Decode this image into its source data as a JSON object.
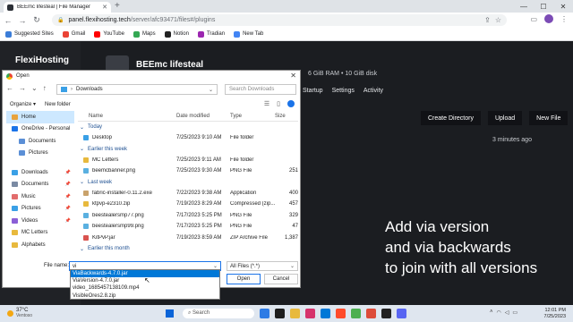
{
  "browser": {
    "tab_title": "BEEmc lifesteal | File Manager",
    "url_host": "panel.flexihosting.tech",
    "url_path": "/server/afc93471/files#/plugins",
    "bookmarks": [
      {
        "label": "Suggested Sites",
        "color": "#3b7dd8"
      },
      {
        "label": "Gmail",
        "color": "#ea4335"
      },
      {
        "label": "YouTube",
        "color": "#ff0000"
      },
      {
        "label": "Maps",
        "color": "#34a853"
      },
      {
        "label": "Notion",
        "color": "#222222"
      },
      {
        "label": "Tradian",
        "color": "#9c27b0"
      },
      {
        "label": "New Tab",
        "color": "#4285f4"
      }
    ]
  },
  "app": {
    "brand": "FlexiHosting",
    "server_title": "BEEmc lifesteal",
    "specs": "6 GiB RAM • 10 GiB disk",
    "nav": [
      "Startup",
      "Settings",
      "Activity"
    ],
    "actions": [
      "Create Directory",
      "Upload",
      "New File"
    ],
    "modified": "3 minutes ago",
    "caption_lines": [
      "Add via version",
      "and via backwards",
      "to join with all versions"
    ]
  },
  "dialog": {
    "title": "Open",
    "path": "Downloads",
    "search_placeholder": "Search Downloads",
    "organize": "Organize ▾",
    "new_folder": "New folder",
    "sidebar": [
      {
        "label": "Home",
        "icon": "home-icon",
        "color": "#e8a33d",
        "selected": true,
        "sub": false,
        "pinned": false
      },
      {
        "label": "OneDrive - Personal",
        "icon": "onedrive-icon",
        "color": "#1a73e8",
        "selected": false,
        "sub": false,
        "pinned": false
      },
      {
        "label": "Documents",
        "icon": "documents-icon",
        "color": "#5b8fd6",
        "selected": false,
        "sub": true,
        "pinned": false
      },
      {
        "label": "Pictures",
        "icon": "pictures-icon",
        "color": "#5b8fd6",
        "selected": false,
        "sub": true,
        "pinned": false
      },
      {
        "label": "",
        "icon": "spacer",
        "color": "transparent",
        "selected": false,
        "sub": false,
        "pinned": false
      },
      {
        "label": "Downloads",
        "icon": "downloads-icon",
        "color": "#3aa0e6",
        "selected": false,
        "sub": false,
        "pinned": true
      },
      {
        "label": "Documents",
        "icon": "documents-icon",
        "color": "#7a8aa3",
        "selected": false,
        "sub": false,
        "pinned": true
      },
      {
        "label": "Music",
        "icon": "music-icon",
        "color": "#e26c6c",
        "selected": false,
        "sub": false,
        "pinned": true
      },
      {
        "label": "Pictures",
        "icon": "pictures-icon",
        "color": "#3aa0e6",
        "selected": false,
        "sub": false,
        "pinned": true
      },
      {
        "label": "Videos",
        "icon": "videos-icon",
        "color": "#8b5fd6",
        "selected": false,
        "sub": false,
        "pinned": true
      },
      {
        "label": "MC Letters",
        "icon": "folder-icon",
        "color": "#e8b93d",
        "selected": false,
        "sub": false,
        "pinned": false
      },
      {
        "label": "Alphabets",
        "icon": "folder-icon",
        "color": "#e8b93d",
        "selected": false,
        "sub": false,
        "pinned": false
      }
    ],
    "columns": [
      "Name",
      "Date modified",
      "Type",
      "Size"
    ],
    "groups": [
      {
        "label": "Today",
        "files": [
          {
            "name": "Desktop",
            "date": "7/25/2023 9:10 AM",
            "type": "File folder",
            "size": "",
            "color": "#3aa0e6"
          }
        ]
      },
      {
        "label": "Earlier this week",
        "files": [
          {
            "name": "MC Letters",
            "date": "7/25/2023 9:11 AM",
            "type": "File folder",
            "size": "",
            "color": "#e8b93d"
          },
          {
            "name": "beemcbanner.png",
            "date": "7/25/2023 9:30 AM",
            "type": "PNG File",
            "size": "251",
            "color": "#5ab0e0"
          }
        ]
      },
      {
        "label": "Last week",
        "files": [
          {
            "name": "fabric-installer-0.11.2.exe",
            "date": "7/22/2023 9:38 AM",
            "type": "Application",
            "size": "400",
            "color": "#c9a26b"
          },
          {
            "name": "ktpvp-e2310.zip",
            "date": "7/19/2023 8:29 AM",
            "type": "Compressed (zip...",
            "size": "457",
            "color": "#e8b93d"
          },
          {
            "name": "beestealersmp77.png",
            "date": "7/17/2023 5:25 PM",
            "type": "PNG File",
            "size": "329",
            "color": "#5ab0e0"
          },
          {
            "name": "beestealersmp99.png",
            "date": "7/17/2023 5:25 PM",
            "type": "PNG File",
            "size": "47",
            "color": "#5ab0e0"
          },
          {
            "name": "KitPvP.jar",
            "date": "7/19/2023 8:59 AM",
            "type": "ZIP Archive File",
            "size": "1,387",
            "color": "#d9534f"
          }
        ]
      },
      {
        "label": "Earlier this month",
        "files": []
      }
    ],
    "filename_label": "File name:",
    "filename_value": "vi",
    "filetype": "All Files (*.*)",
    "open": "Open",
    "cancel": "Cancel",
    "autocomplete": [
      "ViaBackwards-4.7.0.jar",
      "ViaVersion-4.7.0.jar",
      "video_1685457138109.mp4",
      "VisibleOres2.8.zip"
    ],
    "autocomplete_selected": 0
  },
  "taskbar": {
    "temp": "37°C",
    "location": "Ventoso",
    "search": "Search",
    "apps": [
      "#2d7be5",
      "#1e1e1e",
      "#e8b93d",
      "#d6336c",
      "#0078d7",
      "#ff4b2b",
      "#4caf50",
      "#dd4b39",
      "#222222",
      "#5865f2"
    ],
    "time": "12:01 PM",
    "date": "7/25/2023"
  }
}
